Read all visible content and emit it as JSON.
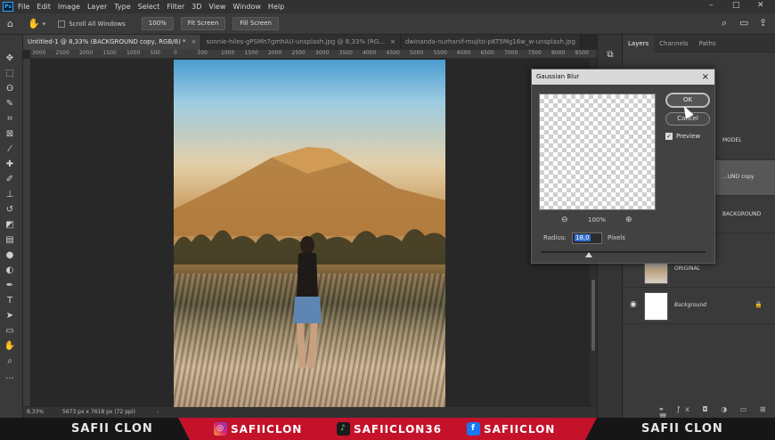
{
  "menubar": {
    "logo": "Ps",
    "items": [
      "File",
      "Edit",
      "Image",
      "Layer",
      "Type",
      "Select",
      "Filter",
      "3D",
      "View",
      "Window",
      "Help"
    ]
  },
  "options_bar": {
    "scroll_all_windows": "Scroll All Windows",
    "zoom_value": "100%",
    "fit_screen": "Fit Screen",
    "fill_screen": "Fill Screen"
  },
  "tabs": [
    {
      "label": "Untitled-1 @ 8,33% (BACKGROUND copy, RGB/8) *",
      "close": "×"
    },
    {
      "label": "sonnie-hiles-gPSMh7gmhAU-unsplash.jpg @ 8,33% (RG...",
      "close": "×"
    },
    {
      "label": "dwinanda-nurhanif-mujito-pKT5Mg16w_w-unsplash.jpg",
      "close": ""
    }
  ],
  "ruler_ticks": [
    "3000",
    "2500",
    "2000",
    "1500",
    "1000",
    "500",
    "0",
    "500",
    "1000",
    "1500",
    "2000",
    "2500",
    "3000",
    "3500",
    "4000",
    "4500",
    "5000",
    "5500",
    "6000",
    "6500",
    "7000",
    "7500",
    "8000",
    "8500"
  ],
  "status": {
    "zoom": "8,33%",
    "doc_size": "5673 px x 7618 px (72 ppi)"
  },
  "layers_panel": {
    "tabs": [
      "Layers",
      "Channels",
      "Paths"
    ],
    "layers": [
      {
        "name": "MODEL",
        "italic": false
      },
      {
        "name": "...UND copy",
        "italic": false
      },
      {
        "name": "BACKGROUND",
        "italic": false
      },
      {
        "name": "ORIGINAL",
        "italic": false
      },
      {
        "name": "Background",
        "italic": true
      }
    ]
  },
  "dialog": {
    "title": "Gaussian Blur",
    "close": "×",
    "ok": "OK",
    "cancel": "Cancel",
    "preview_label": "Preview",
    "zoom": "100%",
    "radius_label": "Radius:",
    "radius_value": "18,0",
    "radius_unit": "Pixels"
  },
  "banner": {
    "left": "SAFII CLON",
    "instagram": "SAFIICLON",
    "tiktok": "SAFIICLON36",
    "facebook": "SAFIICLON",
    "right": "SAFII CLON"
  },
  "colors": {
    "accent_blue": "#31a8ff",
    "banner_red": "#c4122b",
    "selection_blue": "#2f6fd2"
  }
}
